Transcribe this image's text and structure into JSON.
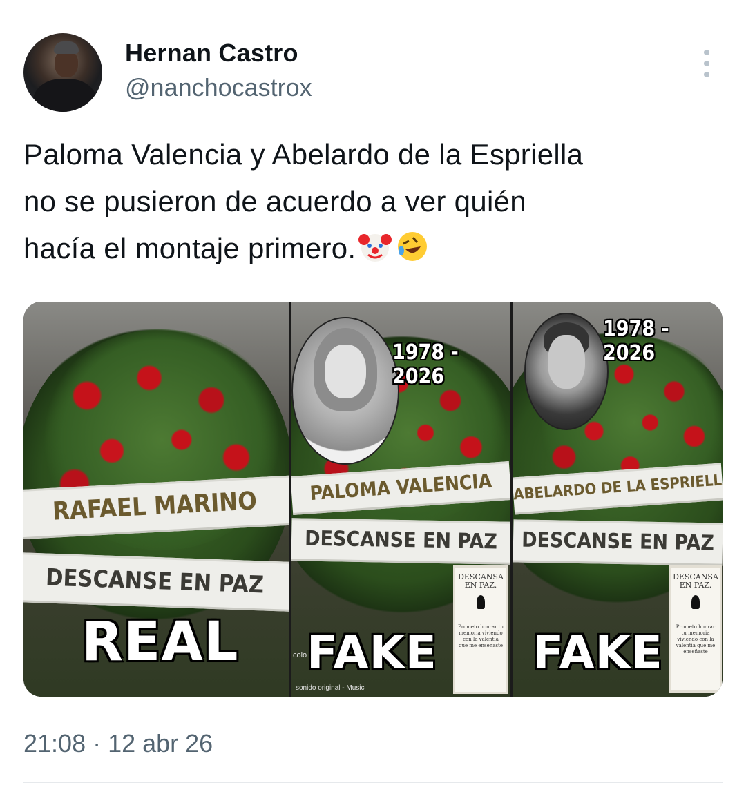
{
  "tweet": {
    "author_name": "Hernan Castro",
    "author_handle": "@nanchocastrox",
    "text_lines": [
      "Paloma Valencia y Abelardo de la Espriella",
      "no se pusieron de acuerdo a ver quién",
      "hacía el montaje primero."
    ],
    "emojis": [
      "clown-face-emoji",
      "rolling-on-floor-laughing-emoji"
    ],
    "timestamp": "21:08 · 12 abr 26"
  },
  "media": {
    "panels": [
      {
        "ribbon_name": "RAFAEL MARINO",
        "ribbon_message": "DESCANSE EN PAZ",
        "verdict": "REAL"
      },
      {
        "ribbon_name": "PALOMA VALENCIA",
        "ribbon_message": "DESCANSE EN PAZ",
        "verdict": "FAKE",
        "years": "1978 - 2026",
        "card_title": "DESCANSA EN PAZ.",
        "card_body": "Prometo honrar tu memoria viviendo con la valentía que me enseñaste",
        "overlay_text": "colo",
        "overlay_audio": "sonido original - Music"
      },
      {
        "ribbon_name": "ABELARDO DE LA ESPRIELLA",
        "ribbon_message": "DESCANSE EN PAZ",
        "verdict": "FAKE",
        "years": "1978 - 2026",
        "card_title": "DESCANSA EN PAZ.",
        "card_body": "Prometo honrar tu memoria viviendo con la valentía que me enseñaste"
      }
    ]
  },
  "colors": {
    "text_primary": "#0f1419",
    "text_secondary": "#536471",
    "divider": "#e6e9ec",
    "rose_red": "#c5121a"
  }
}
